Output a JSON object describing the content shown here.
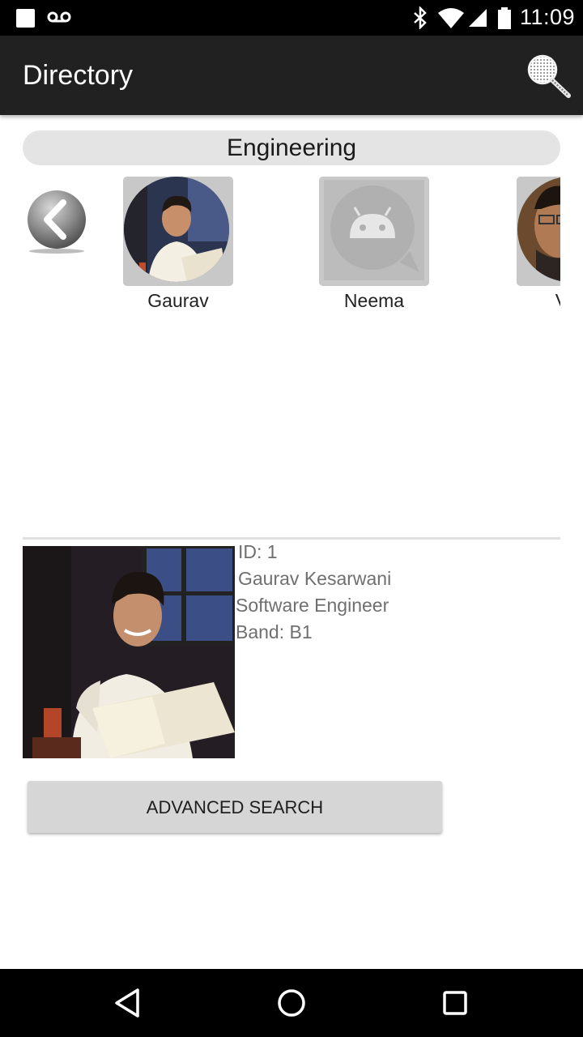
{
  "status_bar": {
    "time": "11:09",
    "icons": [
      "notification-square-icon",
      "voicemail-icon",
      "bluetooth-icon",
      "wifi-icon",
      "cell-signal-icon",
      "battery-icon"
    ]
  },
  "app_bar": {
    "title": "Directory",
    "search_icon": "search-magnifier-icon"
  },
  "department": {
    "name": "Engineering"
  },
  "carousel": {
    "back_icon": "chevron-left-icon",
    "members": [
      {
        "name": "Gaurav",
        "avatar": "photo"
      },
      {
        "name": "Neema",
        "avatar": "android-placeholder"
      },
      {
        "name": "Vire",
        "avatar": "photo"
      }
    ]
  },
  "detail": {
    "id_line": "ID: 1",
    "full_name": "Gaurav Kesarwani",
    "title": "Software Engineer",
    "band_line": "Band: B1"
  },
  "actions": {
    "advanced_search_label": "ADVANCED SEARCH"
  },
  "nav_bar": {
    "icons": [
      "back-triangle-icon",
      "home-circle-icon",
      "recents-square-icon"
    ]
  },
  "colors": {
    "status_bar": "#000000",
    "app_bar": "#212121",
    "pill": "#e4e4e4",
    "button": "#d6d6d6",
    "detail_text": "#6f6f6f"
  }
}
